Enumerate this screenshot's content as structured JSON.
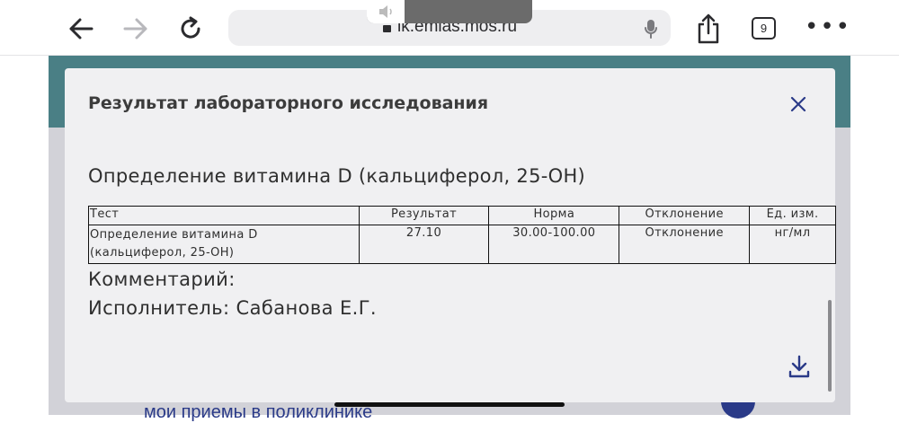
{
  "browser": {
    "url": "lk.emias.mos.ru",
    "tabs_count": "9",
    "colors": {
      "icon": "#2b2b2e",
      "disabled_icon": "#b8b8bc"
    }
  },
  "page": {
    "link_text": "мои приемы в поликлинике",
    "colors": {
      "teal": "#4a7f85",
      "navy": "#2a3a88"
    }
  },
  "modal": {
    "title": "Результат лабораторного исследования",
    "subtitle": "Определение витамина D (кальциферол, 25-OH)",
    "table": {
      "headers": [
        "Тест",
        "Результат",
        "Норма",
        "Отклонение",
        "Ед. изм."
      ],
      "rows": [
        [
          "Определение витамина D (кальциферол, 25-OH)",
          "27.10",
          "30.00-100.00",
          "Отклонение",
          "нг/мл"
        ]
      ]
    },
    "comment_label": "Комментарий:",
    "executor_label": "Исполнитель: Сабанова Е.Г."
  },
  "icons": [
    "back-arrow-icon",
    "forward-arrow-icon",
    "reload-icon",
    "lock-icon",
    "microphone-icon",
    "share-icon",
    "tabs-icon",
    "more-icon",
    "close-icon",
    "download-icon",
    "speaker-icon"
  ]
}
